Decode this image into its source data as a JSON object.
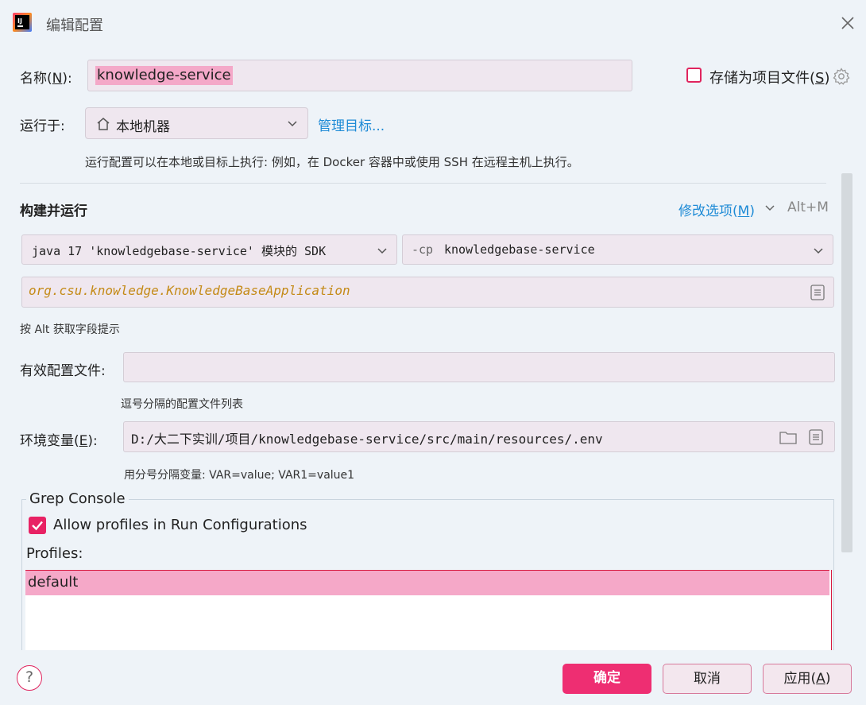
{
  "window": {
    "title": "编辑配置",
    "app_icon": "intellij-idea-icon",
    "close_icon": "close-icon"
  },
  "name_row": {
    "label": "名称(",
    "mnemonic": "N",
    "label_suffix": "):",
    "value": "knowledge-service",
    "store_label": "存储为项目文件(",
    "store_mnemonic": "S",
    "store_suffix": ")",
    "store_checked": false
  },
  "run_on": {
    "label": "运行于:",
    "value": "本地机器",
    "manage_link": "管理目标...",
    "hint": "运行配置可以在本地或目标上执行: 例如，在 Docker 容器中或使用 SSH 在远程主机上执行。"
  },
  "build_run": {
    "title": "构建并运行",
    "modify_options": "修改选项(",
    "modify_mnemonic": "M",
    "modify_suffix": ")",
    "shortcut": "Alt+M",
    "sdk_value": "java 17 'knowledgebase-service' 模块的 SDK",
    "cp_prefix": "-cp",
    "cp_value": "knowledgebase-service",
    "main_class": "org.csu.knowledge.KnowledgeBaseApplication",
    "alt_hint": "按 Alt 获取字段提示"
  },
  "active_profiles": {
    "label": "有效配置文件:",
    "value": "",
    "hint": "逗号分隔的配置文件列表"
  },
  "env_vars": {
    "label": "环境变量(",
    "mnemonic": "E",
    "label_suffix": "):",
    "value": "D:/大二下实训/项目/knowledgebase-service/src/main/resources/.env",
    "hint": "用分号分隔变量: VAR=value; VAR1=value1"
  },
  "grep_console": {
    "legend": "Grep Console",
    "allow_label": "Allow profiles in Run Configurations",
    "allow_checked": true,
    "profiles_label": "Profiles:",
    "profiles": [
      "default"
    ]
  },
  "footer": {
    "help": "?",
    "ok": "确定",
    "cancel": "取消",
    "apply": "应用(",
    "apply_mnemonic": "A",
    "apply_suffix": ")"
  },
  "colors": {
    "accent": "#ee2e72",
    "link": "#1f8bd6",
    "main_class": "#c48a16",
    "selection": "#f5a8c8"
  }
}
